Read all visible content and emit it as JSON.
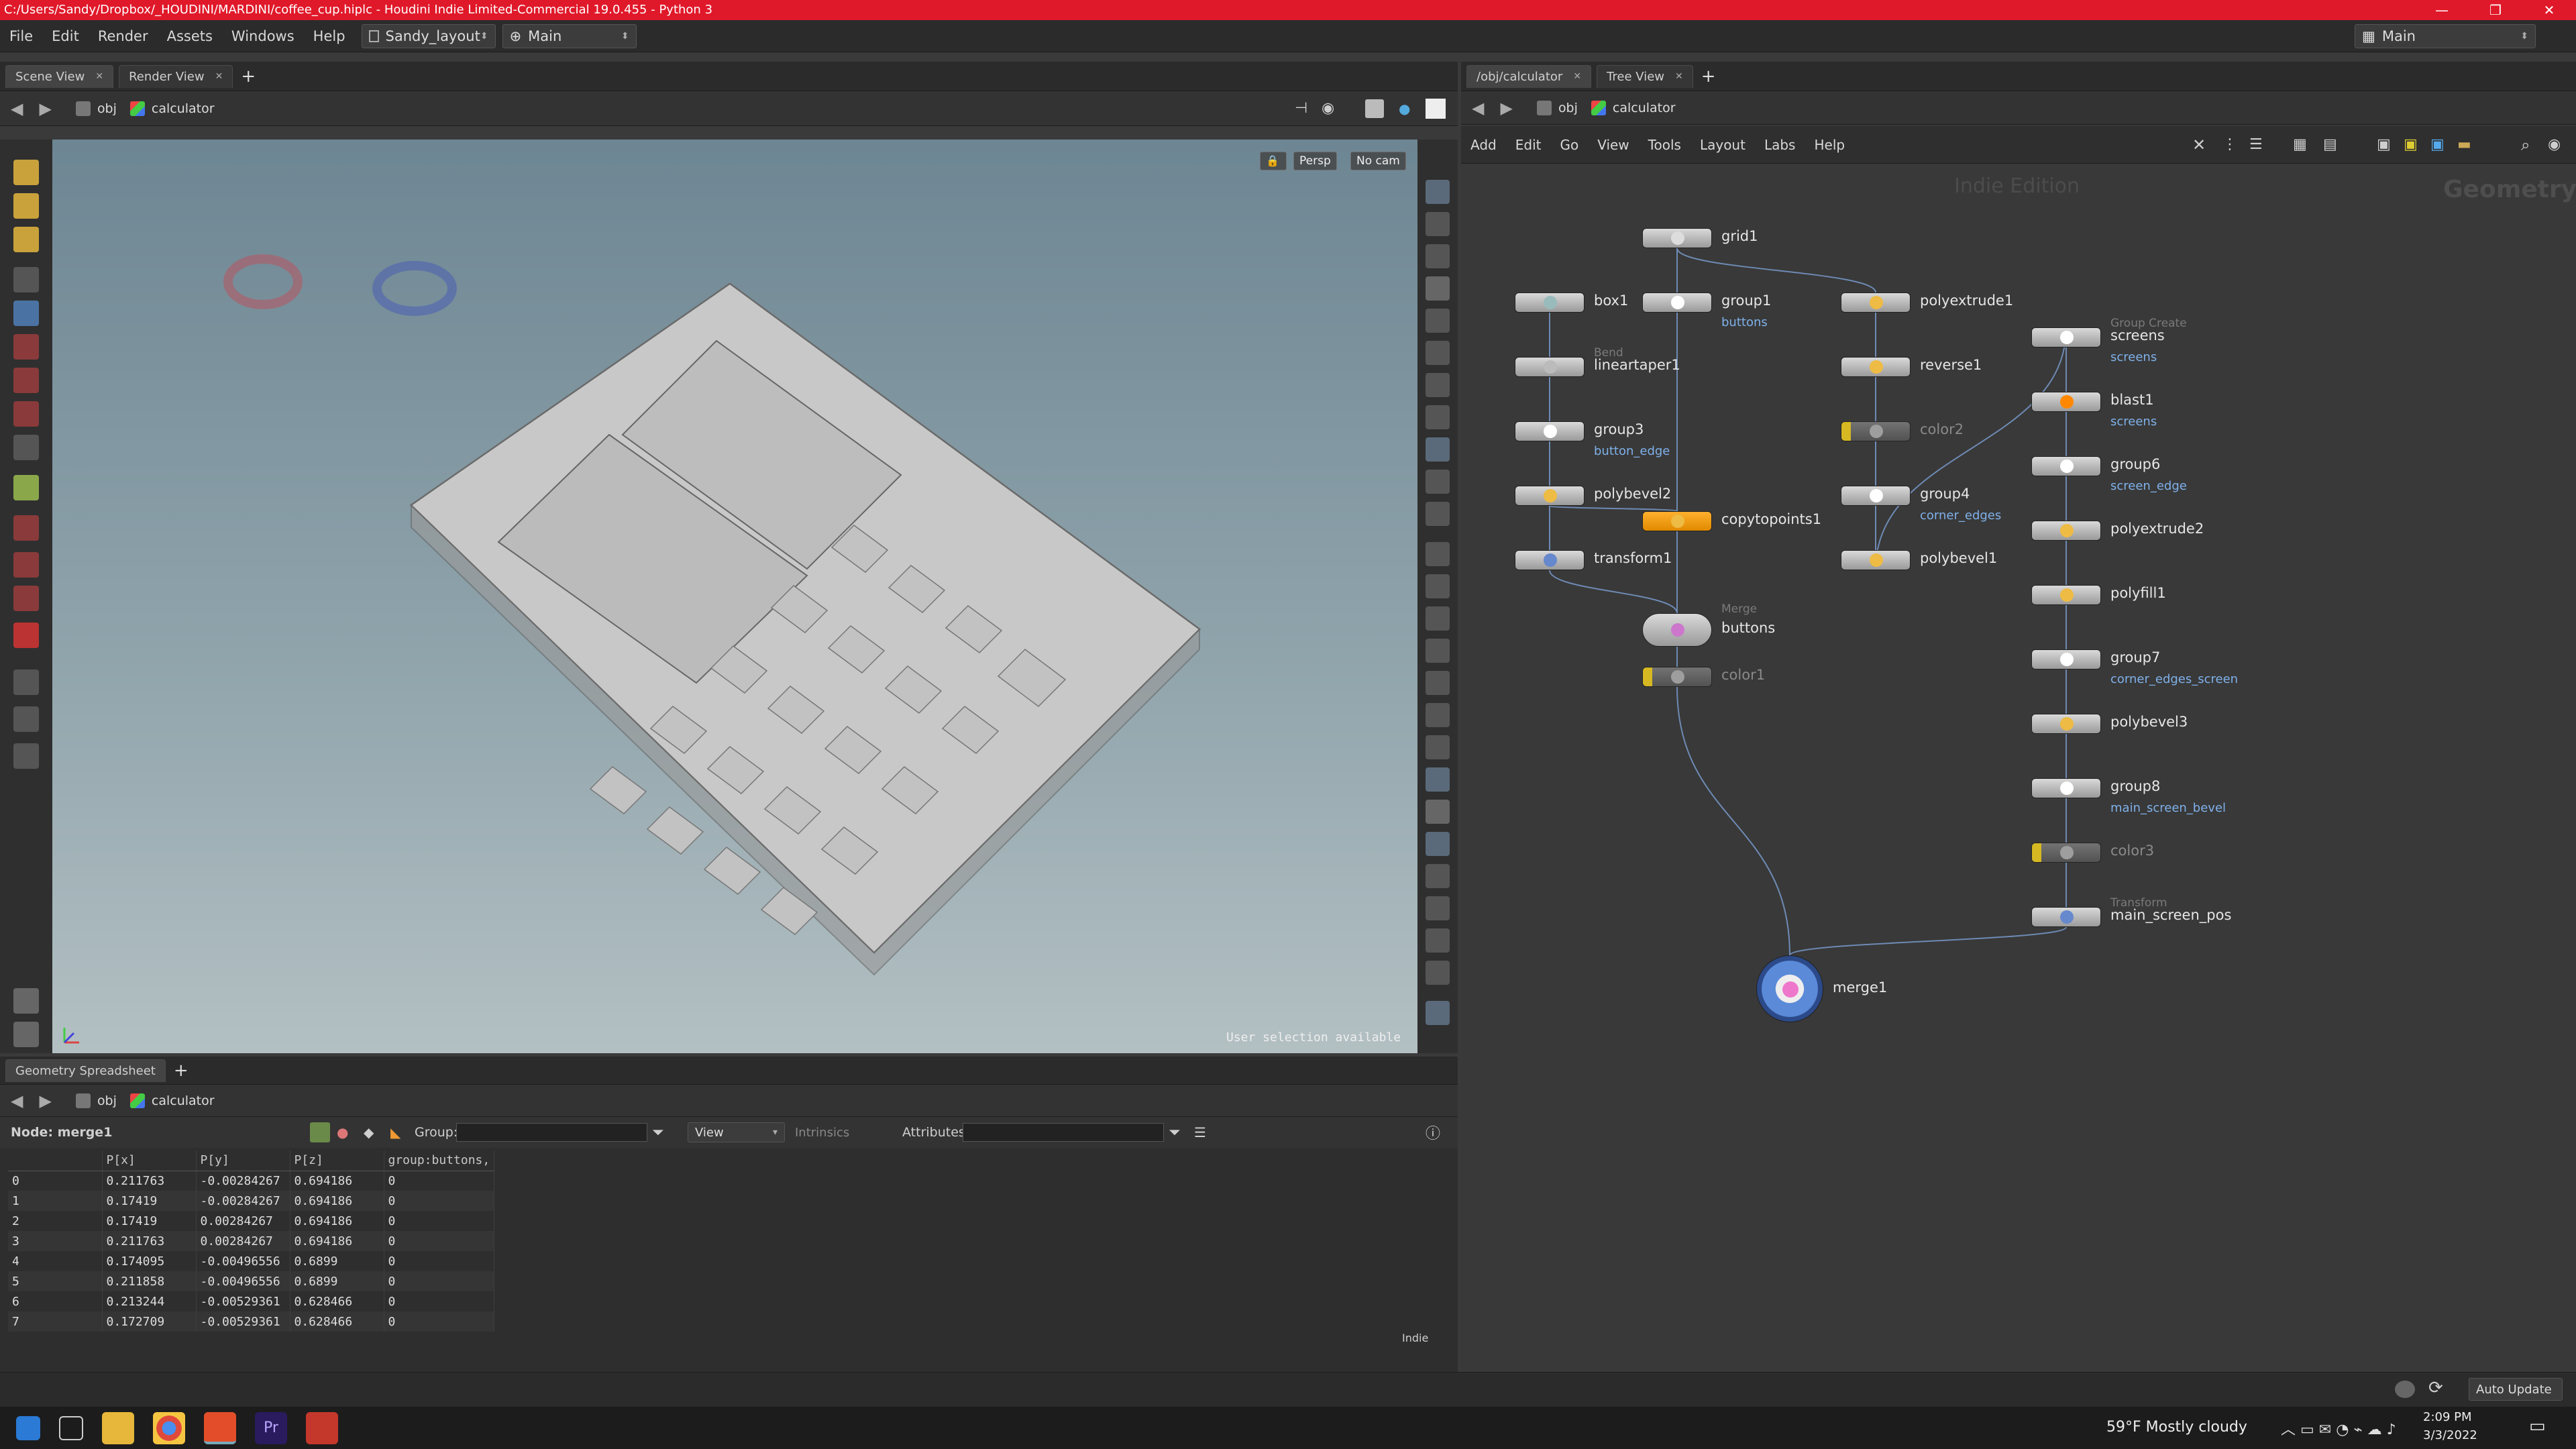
{
  "window": {
    "title": "C:/Users/Sandy/Dropbox/_HOUDINI/MARDINI/coffee_cup.hiplc - Houdini Indie Limited-Commercial 19.0.455 - Python 3"
  },
  "menubar": {
    "items": [
      "File",
      "Edit",
      "Render",
      "Assets",
      "Windows",
      "Help"
    ],
    "desktop": "Sandy_layout",
    "context": "Main",
    "right_context": "Main"
  },
  "left_pane": {
    "tabs": [
      "Scene View",
      "Render View"
    ],
    "path": [
      "obj",
      "calculator"
    ],
    "viewport": {
      "persp": "Persp",
      "cam": "No cam",
      "status": "User selection available"
    }
  },
  "spreadsheet": {
    "tab": "Geometry Spreadsheet",
    "path": [
      "obj",
      "calculator"
    ],
    "node_label": "Node: merge1",
    "group_label": "Group:",
    "view_label": "View",
    "intrinsics_label": "Intrinsics",
    "attributes_label": "Attributes:",
    "columns": [
      "",
      "P[x]",
      "P[y]",
      "P[z]",
      "group:buttons,"
    ],
    "rows": [
      [
        "0",
        "0.211763",
        "-0.00284267",
        "0.694186",
        "0"
      ],
      [
        "1",
        "0.17419",
        "-0.00284267",
        "0.694186",
        "0"
      ],
      [
        "2",
        "0.17419",
        "0.00284267",
        "0.694186",
        "0"
      ],
      [
        "3",
        "0.211763",
        "0.00284267",
        "0.694186",
        "0"
      ],
      [
        "4",
        "0.174095",
        "-0.00496556",
        "0.6899",
        "0"
      ],
      [
        "5",
        "0.211858",
        "-0.00496556",
        "0.6899",
        "0"
      ],
      [
        "6",
        "0.213244",
        "-0.00529361",
        "0.628466",
        "0"
      ],
      [
        "7",
        "0.172709",
        "-0.00529361",
        "0.628466",
        "0"
      ]
    ],
    "footer": "Indie"
  },
  "right_pane": {
    "tabs": [
      "/obj/calculator",
      "Tree View"
    ],
    "path": [
      "obj",
      "calculator"
    ],
    "menu": [
      "Add",
      "Edit",
      "Go",
      "View",
      "Tools",
      "Layout",
      "Labs",
      "Help"
    ],
    "watermark": "Indie Edition",
    "context_label": "Geometry"
  },
  "nodes": [
    {
      "id": "grid1",
      "label": "grid1",
      "sub": "",
      "type": ""
    },
    {
      "id": "box1",
      "label": "box1",
      "sub": "",
      "type": ""
    },
    {
      "id": "group1",
      "label": "group1",
      "sub": "buttons",
      "type": ""
    },
    {
      "id": "polyextrude1",
      "label": "polyextrude1",
      "sub": "",
      "type": ""
    },
    {
      "id": "lineartaper1",
      "label": "lineartaper1",
      "sub": "",
      "type": "Bend"
    },
    {
      "id": "reverse1",
      "label": "reverse1",
      "sub": "",
      "type": ""
    },
    {
      "id": "screens",
      "label": "screens",
      "sub": "screens",
      "type": "Group Create"
    },
    {
      "id": "group3",
      "label": "group3",
      "sub": "button_edge",
      "type": ""
    },
    {
      "id": "color2",
      "label": "color2",
      "sub": "",
      "type": ""
    },
    {
      "id": "blast1",
      "label": "blast1",
      "sub": "screens",
      "type": ""
    },
    {
      "id": "polybevel2",
      "label": "polybevel2",
      "sub": "",
      "type": ""
    },
    {
      "id": "group4",
      "label": "group4",
      "sub": "corner_edges",
      "type": ""
    },
    {
      "id": "group6",
      "label": "group6",
      "sub": "screen_edge",
      "type": ""
    },
    {
      "id": "copytopoints1",
      "label": "copytopoints1",
      "sub": "",
      "type": ""
    },
    {
      "id": "transform1",
      "label": "transform1",
      "sub": "",
      "type": ""
    },
    {
      "id": "polybevel1",
      "label": "polybevel1",
      "sub": "",
      "type": ""
    },
    {
      "id": "polyextrude2",
      "label": "polyextrude2",
      "sub": "",
      "type": ""
    },
    {
      "id": "buttons",
      "label": "buttons",
      "sub": "",
      "type": "Merge"
    },
    {
      "id": "polyfill1",
      "label": "polyfill1",
      "sub": "",
      "type": ""
    },
    {
      "id": "color1",
      "label": "color1",
      "sub": "",
      "type": ""
    },
    {
      "id": "group7",
      "label": "group7",
      "sub": "corner_edges_screen",
      "type": ""
    },
    {
      "id": "polybevel3",
      "label": "polybevel3",
      "sub": "",
      "type": ""
    },
    {
      "id": "group8",
      "label": "group8",
      "sub": "main_screen_bevel",
      "type": ""
    },
    {
      "id": "color3",
      "label": "color3",
      "sub": "",
      "type": ""
    },
    {
      "id": "main_screen_pos",
      "label": "main_screen_pos",
      "sub": "",
      "type": "Transform"
    },
    {
      "id": "merge1",
      "label": "merge1",
      "sub": "",
      "type": ""
    }
  ],
  "statusbar": {
    "auto_update": "Auto Update"
  },
  "taskbar": {
    "weather": "59°F  Mostly cloudy",
    "time": "2:09 PM",
    "date": "3/3/2022"
  }
}
